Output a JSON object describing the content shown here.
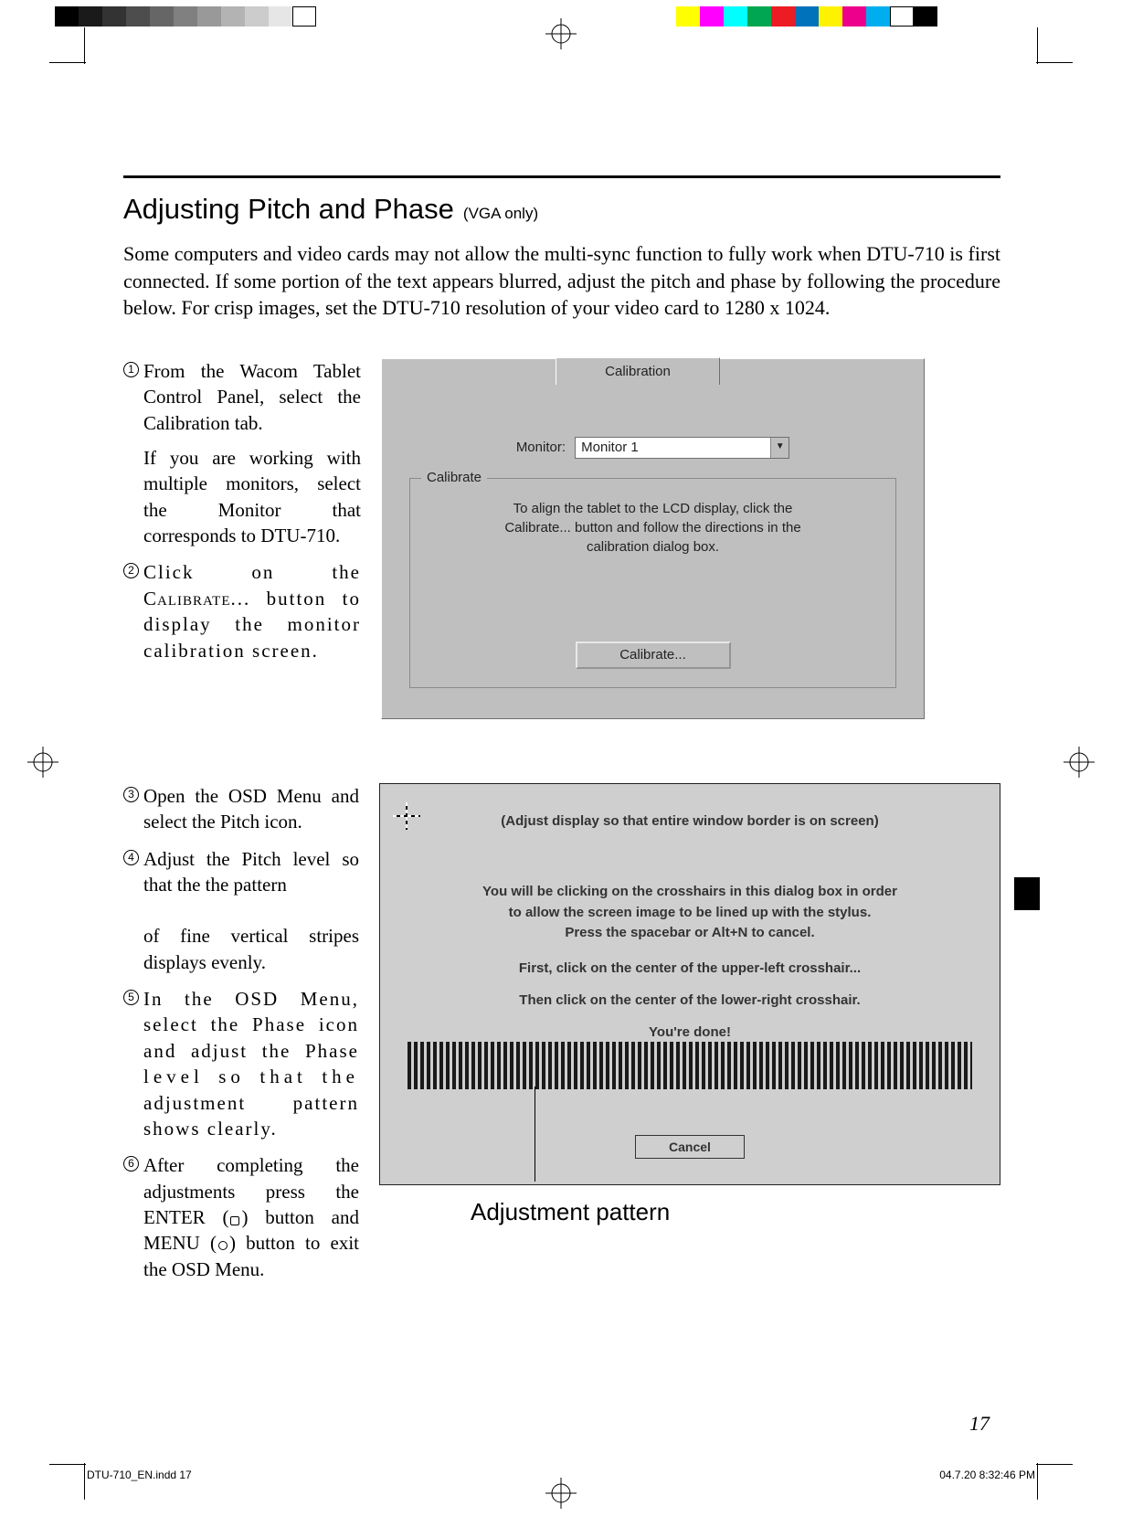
{
  "registration": {
    "grayscale": [
      "#000000",
      "#1a1a1a",
      "#333333",
      "#4d4d4d",
      "#666666",
      "#808080",
      "#999999",
      "#b3b3b3",
      "#cccccc",
      "#e6e6e6",
      "#ffffff"
    ],
    "colors": [
      "#ffff00",
      "#ff00ff",
      "#00ffff",
      "#00a651",
      "#ed1c24",
      "#0072bc",
      "#fff200",
      "#ec008c",
      "#00aeef",
      "#ffffff",
      "#000000"
    ]
  },
  "title": {
    "main": "Adjusting Pitch and Phase",
    "sub": "(VGA only)"
  },
  "intro": "Some computers and video cards may not allow the multi-sync function to fully work when DTU-710 is first connected.  If some portion of the text appears blurred, adjust the pitch and phase by following the procedure below.  For crisp images, set the DTU-710 resolution of your video card to 1280 x 1024.",
  "steps_a": [
    {
      "num": "1",
      "text": "From the Wacom Tablet Control Panel, select the Calibration tab.",
      "sub": "If you are working with multiple monitors, select the Monitor that corresponds to DTU-710."
    },
    {
      "num": "2",
      "pre": "Click on the ",
      "sc": "Calibrate",
      "post": "... button to display the monitor calibration screen."
    }
  ],
  "steps_b": [
    {
      "num": "3",
      "text": "Open the OSD Menu and select the Pitch icon."
    },
    {
      "num": "4",
      "text": "Adjust the Pitch level so that the the pattern",
      "sub": "of fine vertical stripes displays evenly."
    },
    {
      "num": "5",
      "pre": "In the OSD Menu, select the Phase icon and adjust the Phase ",
      "wide": "level so that the",
      "post": " adjustment pattern shows clearly."
    },
    {
      "num": "6",
      "pre": "After completing the adjustments press the ENTER (",
      "icon1": "sq",
      "mid": ") button and MENU (",
      "icon2": "circ",
      "post": ") button to exit the OSD Menu."
    }
  ],
  "panel1": {
    "tab": "Calibration",
    "monitor_label": "Monitor:",
    "monitor_value": "Monitor 1",
    "group_legend": "Calibrate",
    "help1": "To align the tablet to the LCD display, click the",
    "help2": "Calibrate... button and follow the directions in the",
    "help3": "calibration dialog box.",
    "button": "Calibrate..."
  },
  "panel2": {
    "hint": "(Adjust display so that entire window border is on screen)",
    "t1": "You will be clicking on the crosshairs in this dialog box in order",
    "t2": "to allow the screen image to be lined up with the stylus.",
    "t3": "Press the spacebar or Alt+N to cancel.",
    "l1": "First, click on the center of the upper-left crosshair...",
    "l2": "Then click on the center of the lower-right crosshair.",
    "l3": "You're done!",
    "cancel": "Cancel"
  },
  "adjustment_label": "Adjustment pattern",
  "page_number": "17",
  "footer": {
    "file": "DTU-710_EN.indd   17",
    "date": "04.7.20   8:32:46 PM"
  }
}
